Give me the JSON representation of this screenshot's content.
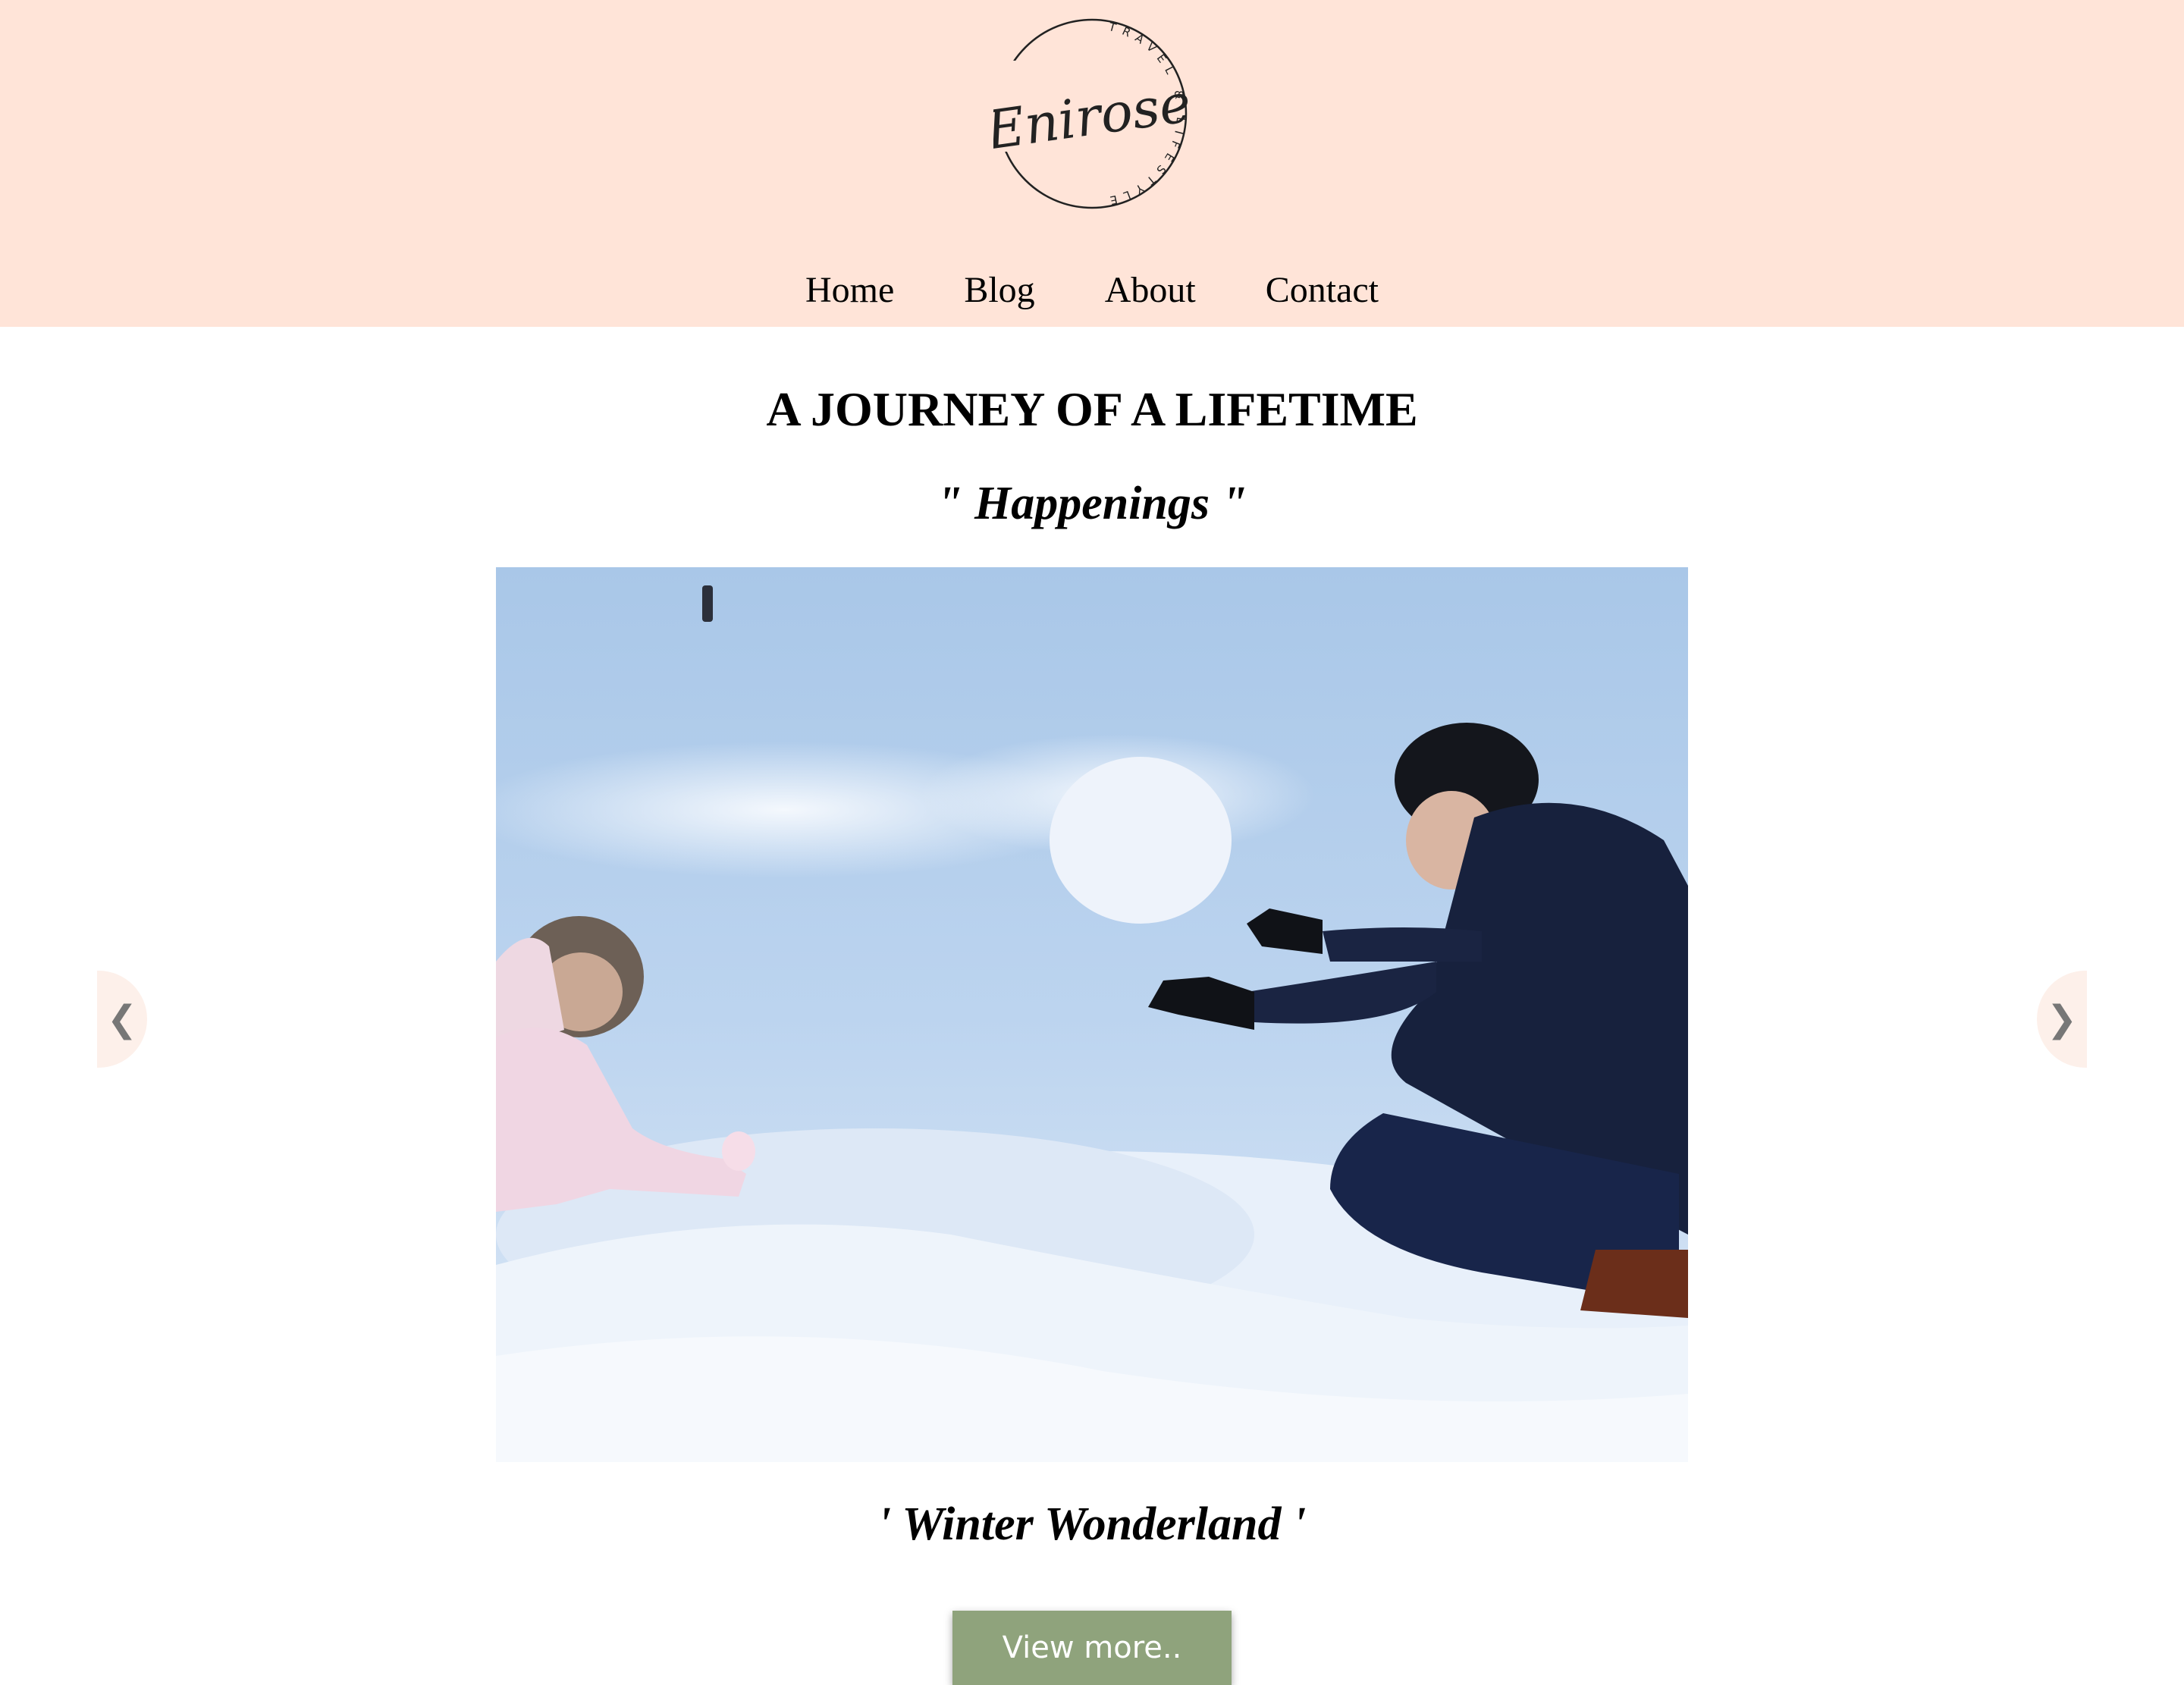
{
  "brand": {
    "logo_name": "Enirose",
    "logo_tagline": "TRAVEL & LIFESTYLE"
  },
  "nav": {
    "items": [
      "Home",
      "Blog",
      "About",
      "Contact"
    ]
  },
  "hero": {
    "title": "A JOURNEY OF A LIFETIME",
    "subtitle": "\" Happenings \""
  },
  "slider": {
    "prev_icon": "❮",
    "next_icon": "❯",
    "caption": "' Winter Wonderland '",
    "button_label": "View more.."
  },
  "colors": {
    "header_bg": "#ffe4d8",
    "button_bg": "#8fa37c",
    "arrow_bg": "#fdf0ea"
  }
}
